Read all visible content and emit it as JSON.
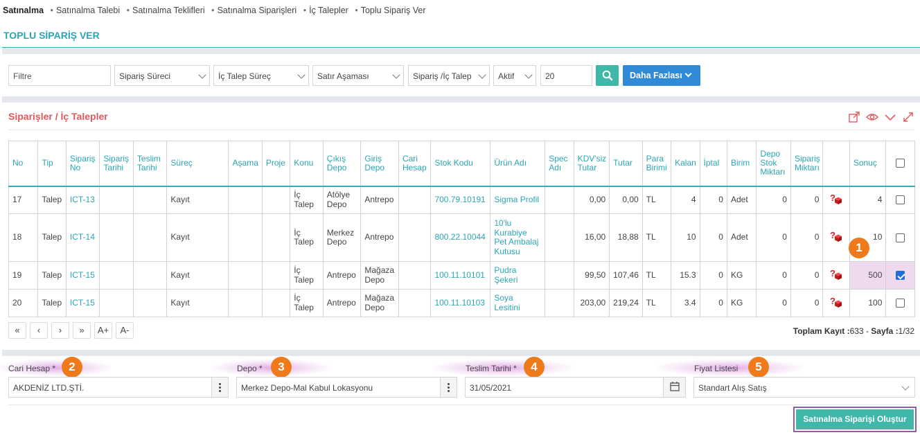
{
  "breadcrumb": {
    "root": "Satınalma",
    "items": [
      "Satınalma Talebi",
      "Satınalma Teklifleri",
      "Satınalma Siparişleri",
      "İç Talepler",
      "Toplu Sipariş Ver"
    ]
  },
  "page_title": "TOPLU SİPARİŞ VER",
  "filters": {
    "filter_placeholder": "Filtre",
    "siparis_sureci": "Sipariş Süreci",
    "ic_talep_surec": "İç Talep Süreç",
    "satir_asamasi": "Satır Aşaması",
    "siparis_ic_talep": "Sipariş /İç Talep",
    "aktif": "Aktif",
    "count": "20",
    "more_label": "Daha Fazlası"
  },
  "panel": {
    "title": "Siparişler / İç Talepler",
    "tools": [
      "export-icon",
      "eye-icon",
      "collapse-icon",
      "expand-icon"
    ]
  },
  "table": {
    "headers": [
      "No",
      "Tip",
      "Sipariş No",
      "Sipariş Tarihi",
      "Teslim Tarihi",
      "Süreç",
      "Aşama",
      "Proje",
      "Konu",
      "Çıkış Depo",
      "Giriş Depo",
      "Cari Hesap",
      "Stok Kodu",
      "Ürün Adı",
      "Spec Adı",
      "KDV'siz Tutar",
      "Tutar",
      "Para Birimi",
      "Kalan",
      "İptal",
      "Birim",
      "Depo Stok Miktarı",
      "Sipariş Miktarı",
      "",
      "Sonuç",
      ""
    ],
    "rows": [
      {
        "no": "17",
        "tip": "Talep",
        "siparis_no": "ICT-13",
        "siparis_tarihi": "",
        "teslim_tarihi": "",
        "surec": "Kayıt",
        "asama": "",
        "proje": "",
        "konu": "İç Talep",
        "cikis_depo": "Atölye Depo",
        "giris_depo": "Antrepo",
        "cari": "",
        "stok_kodu": "700.79.10191",
        "urun_adi": "Sigma Profil",
        "spec": "",
        "kdvsiz": "0,00",
        "tutar": "0,00",
        "para": "TL",
        "kalan": "4",
        "iptal": "0",
        "birim": "Adet",
        "depo_stok": "0",
        "siparis_miktari": "0",
        "sonuc": "4",
        "checked": false
      },
      {
        "no": "18",
        "tip": "Talep",
        "siparis_no": "ICT-14",
        "siparis_tarihi": "",
        "teslim_tarihi": "",
        "surec": "Kayıt",
        "asama": "",
        "proje": "",
        "konu": "İç Talep",
        "cikis_depo": "Merkez Depo",
        "giris_depo": "Antrepo",
        "cari": "",
        "stok_kodu": "800.22.10044",
        "urun_adi": "10'lu Kurabiye Pet Ambalaj Kutusu",
        "spec": "",
        "kdvsiz": "16,00",
        "tutar": "18,88",
        "para": "TL",
        "kalan": "10",
        "iptal": "0",
        "birim": "Adet",
        "depo_stok": "0",
        "siparis_miktari": "0",
        "sonuc": "10",
        "checked": false
      },
      {
        "no": "19",
        "tip": "Talep",
        "siparis_no": "ICT-15",
        "siparis_tarihi": "",
        "teslim_tarihi": "",
        "surec": "Kayıt",
        "asama": "",
        "proje": "",
        "konu": "İç Talep",
        "cikis_depo": "Antrepo",
        "giris_depo": "Mağaza Depo",
        "cari": "",
        "stok_kodu": "100.11.10101",
        "urun_adi": "Pudra Şekeri",
        "spec": "",
        "kdvsiz": "99,50",
        "tutar": "107,46",
        "para": "TL",
        "kalan": "15.3",
        "iptal": "0",
        "birim": "KG",
        "depo_stok": "0",
        "siparis_miktari": "0",
        "sonuc": "500",
        "checked": true
      },
      {
        "no": "20",
        "tip": "Talep",
        "siparis_no": "ICT-15",
        "siparis_tarihi": "",
        "teslim_tarihi": "",
        "surec": "Kayıt",
        "asama": "",
        "proje": "",
        "konu": "İç Talep",
        "cikis_depo": "Antrepo",
        "giris_depo": "Mağaza Depo",
        "cari": "",
        "stok_kodu": "100.11.10103",
        "urun_adi": "Soya Lesitini",
        "spec": "",
        "kdvsiz": "203,00",
        "tutar": "219,24",
        "para": "TL",
        "kalan": "3.4",
        "iptal": "0",
        "birim": "KG",
        "depo_stok": "0",
        "siparis_miktari": "0",
        "sonuc": "100",
        "checked": false
      }
    ]
  },
  "pager": {
    "buttons": [
      "«",
      "‹",
      "›",
      "»",
      "A+",
      "A-"
    ],
    "total_label": "Toplam Kayıt :",
    "total": "633",
    "sep": " - ",
    "page_label": "Sayfa :",
    "page": "1/32"
  },
  "form": {
    "cari_label": "Cari Hesap *",
    "cari_value": "AKDENİZ LTD.ŞTİ.",
    "depo_label": "Depo *",
    "depo_value": "Merkez Depo-Mal Kabul Lokasyonu",
    "teslim_label": "Teslim Tarihi *",
    "teslim_value": "31/05/2021",
    "fiyat_label": "Fiyat Listesi",
    "fiyat_value": "Standart Alış Satış"
  },
  "badges": [
    "1",
    "2",
    "3",
    "4",
    "5"
  ],
  "create_button": "Satınalma Siparişi Oluştur",
  "colors": {
    "accent": "#2aa5b4",
    "panel_title": "#e2585d",
    "badge": "#ef7a1c",
    "primary_btn": "#2f8ad8",
    "success_btn": "#3fb8a9",
    "highlight": "#efd9ef",
    "outline": "#8a5ea8"
  }
}
